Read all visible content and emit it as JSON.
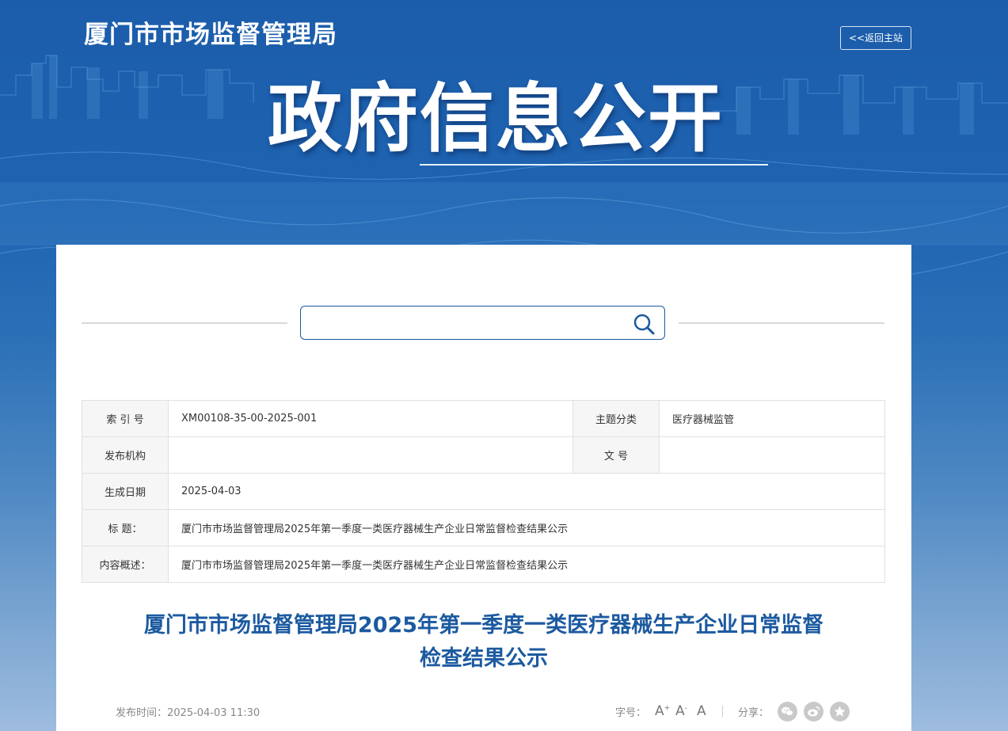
{
  "header": {
    "site_title": "厦门市市场监督管理局",
    "back_label": "<<返回主站",
    "banner_title": "政府信息公开"
  },
  "search": {
    "placeholder": "",
    "icon": "search-icon"
  },
  "meta": {
    "index_label": "索 引 号",
    "index_value": "XM00108-35-00-2025-001",
    "topic_label": "主题分类",
    "topic_value": "医疗器械监管",
    "publisher_label": "发布机构",
    "publisher_value": "",
    "docno_label": "文  号",
    "docno_value": "",
    "date_label": "生成日期",
    "date_value": "2025-04-03",
    "title_label": "标  题：",
    "title_value": "厦门市市场监督管理局2025年第一季度一类医疗器械生产企业日常监督检查结果公示",
    "summary_label": "内容概述：",
    "summary_value": "厦门市市场监督管理局2025年第一季度一类医疗器械生产企业日常监督检查结果公示"
  },
  "article": {
    "title_line1": "厦门市市场监督管理局2025年第一季度一类医疗器械生产企业日常监督",
    "title_line2": "检查结果公示",
    "publish_time": "发布时间：2025-04-03 11:30"
  },
  "tools": {
    "font_label": "字号：",
    "font_large": "A",
    "font_large_mark": "+",
    "font_small": "A",
    "font_small_mark": "-",
    "font_default": "A",
    "share_label": "分享：",
    "share_icons": [
      "wechat-icon",
      "weibo-icon",
      "favorite-icon"
    ]
  },
  "colors": {
    "brand_blue": "#1c5aa0",
    "header_blue": "#1c5dab"
  }
}
